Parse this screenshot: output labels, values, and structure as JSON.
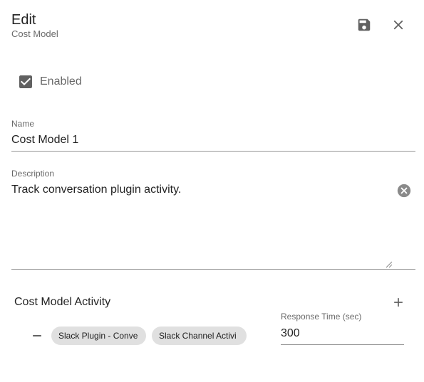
{
  "header": {
    "title": "Edit",
    "subtitle": "Cost Model",
    "save_icon": "save-icon",
    "close_icon": "close-icon"
  },
  "enabled": {
    "label": "Enabled",
    "checked": true
  },
  "name_field": {
    "label": "Name",
    "value": "Cost Model 1"
  },
  "description_field": {
    "label": "Description",
    "value": "Track conversation plugin activity."
  },
  "activity": {
    "title": "Cost Model Activity",
    "rows": [
      {
        "chips": [
          "Slack Plugin - Conve",
          "Slack Channel Activi"
        ],
        "response_time_label": "Response Time (sec)",
        "response_time_value": "300"
      }
    ]
  },
  "colors": {
    "icon": "#616161",
    "chip_bg": "#e0e0e0",
    "checkbox": "#616161"
  }
}
